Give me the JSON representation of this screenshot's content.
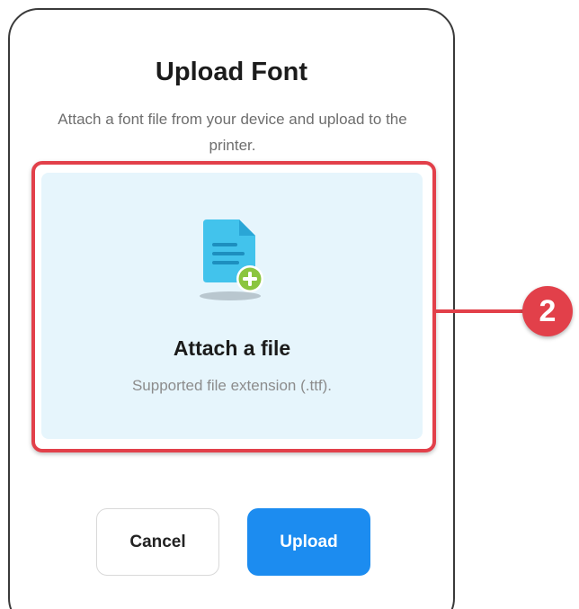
{
  "dialog": {
    "title": "Upload Font",
    "description": "Attach a font file from your device and upload to the printer."
  },
  "dropzone": {
    "icon": "file-add-icon",
    "title": "Attach a file",
    "subtitle": "Supported file extension (.ttf)."
  },
  "buttons": {
    "cancel_label": "Cancel",
    "upload_label": "Upload"
  },
  "callout": {
    "number": "2"
  },
  "colors": {
    "highlight": "#e2404a",
    "upload_button": "#1c8cf0",
    "dropzone_bg": "#e6f5fc",
    "file_icon": "#42c3ec",
    "add_badge": "#8bc53f"
  }
}
